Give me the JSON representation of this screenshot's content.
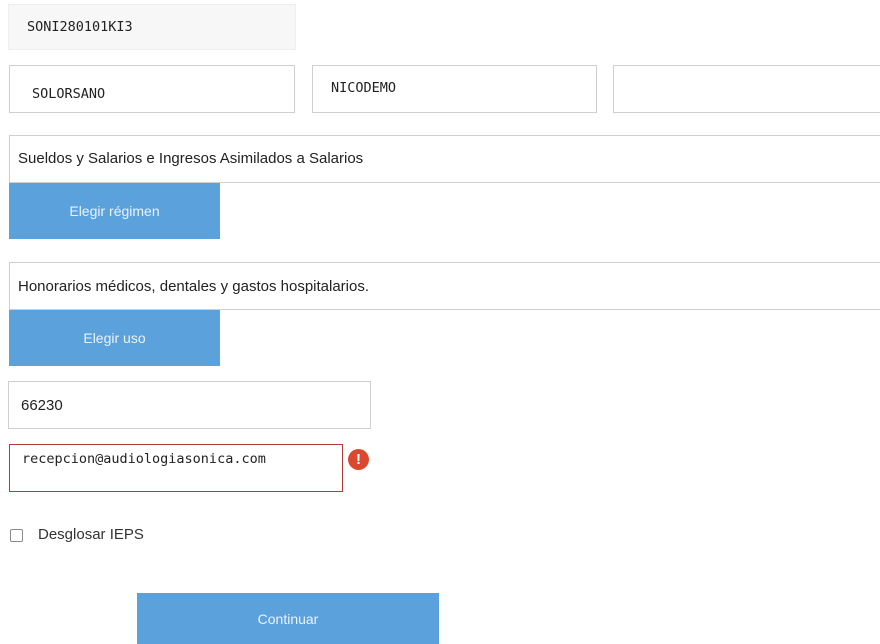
{
  "form": {
    "rfc": {
      "value": "SONI280101KI3"
    },
    "apellido_paterno": {
      "value": "SOLORSANO"
    },
    "apellido_materno": {
      "value": "NICODEMO"
    },
    "nombre": {
      "value": ""
    },
    "regimen": {
      "value": "Sueldos y Salarios e Ingresos Asimilados a Salarios",
      "button_label": "Elegir régimen"
    },
    "uso": {
      "value": "Honorarios médicos, dentales y gastos hospitalarios.",
      "button_label": "Elegir uso"
    },
    "codigo_postal": {
      "value": "66230"
    },
    "email": {
      "value": "recepcion@audiologiasonica.com",
      "error_icon": "!"
    },
    "desglosar_ieps": {
      "label": "Desglosar IEPS",
      "checked": false
    },
    "continue_button": {
      "label": "Continuar"
    }
  },
  "colors": {
    "button_bg": "#5ba1dc",
    "error_border": "#b33a3a",
    "error_icon": "#d9482f"
  },
  "icons": {
    "email_error": "exclamation-circle-icon"
  }
}
